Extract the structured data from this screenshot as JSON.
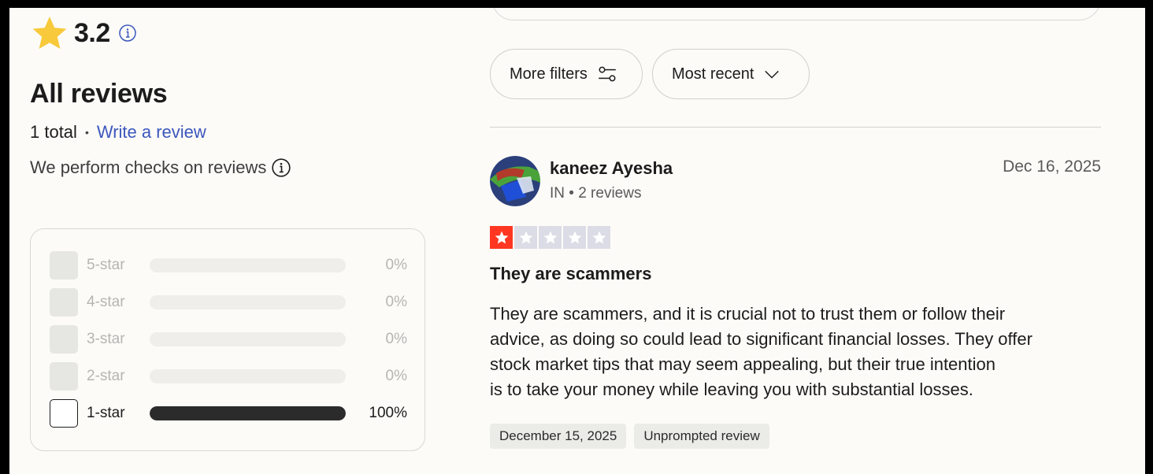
{
  "summary": {
    "rating": "3.2",
    "title": "All reviews",
    "total": "1 total",
    "write_review": "Write a review",
    "checks": "We perform checks on reviews"
  },
  "distribution": [
    {
      "label": "5-star",
      "percent": "0%",
      "fill": 0,
      "active": false
    },
    {
      "label": "4-star",
      "percent": "0%",
      "fill": 0,
      "active": false
    },
    {
      "label": "3-star",
      "percent": "0%",
      "fill": 0,
      "active": false
    },
    {
      "label": "2-star",
      "percent": "0%",
      "fill": 0,
      "active": false
    },
    {
      "label": "1-star",
      "percent": "100%",
      "fill": 1.0,
      "active": true
    }
  ],
  "filters": {
    "more_filters": "More filters",
    "sort": "Most recent"
  },
  "review": {
    "name": "kaneez Ayesha",
    "meta": "IN • 2 reviews",
    "date": "Dec 16, 2025",
    "stars": 1,
    "title": "They are scammers",
    "body_lines": [
      "They are scammers, and it is crucial not to trust them or follow their",
      "advice, as doing so could lead to significant financial losses. They offer",
      "stock market tips that may seem appealing, but their true intention",
      "is to take your money while leaving you with substantial losses."
    ],
    "experience_date": "December 15, 2025",
    "tag": "Unprompted review"
  },
  "colors": {
    "accent_link": "#3c57bc",
    "star_red": "#ff3722",
    "star_gold": "#f8c93a",
    "bar_fill": "#2b2b2b"
  },
  "icons": {
    "rating_star": "star-icon",
    "info": "info-icon",
    "filter": "sliders-icon",
    "sort": "chevron-down-icon"
  }
}
